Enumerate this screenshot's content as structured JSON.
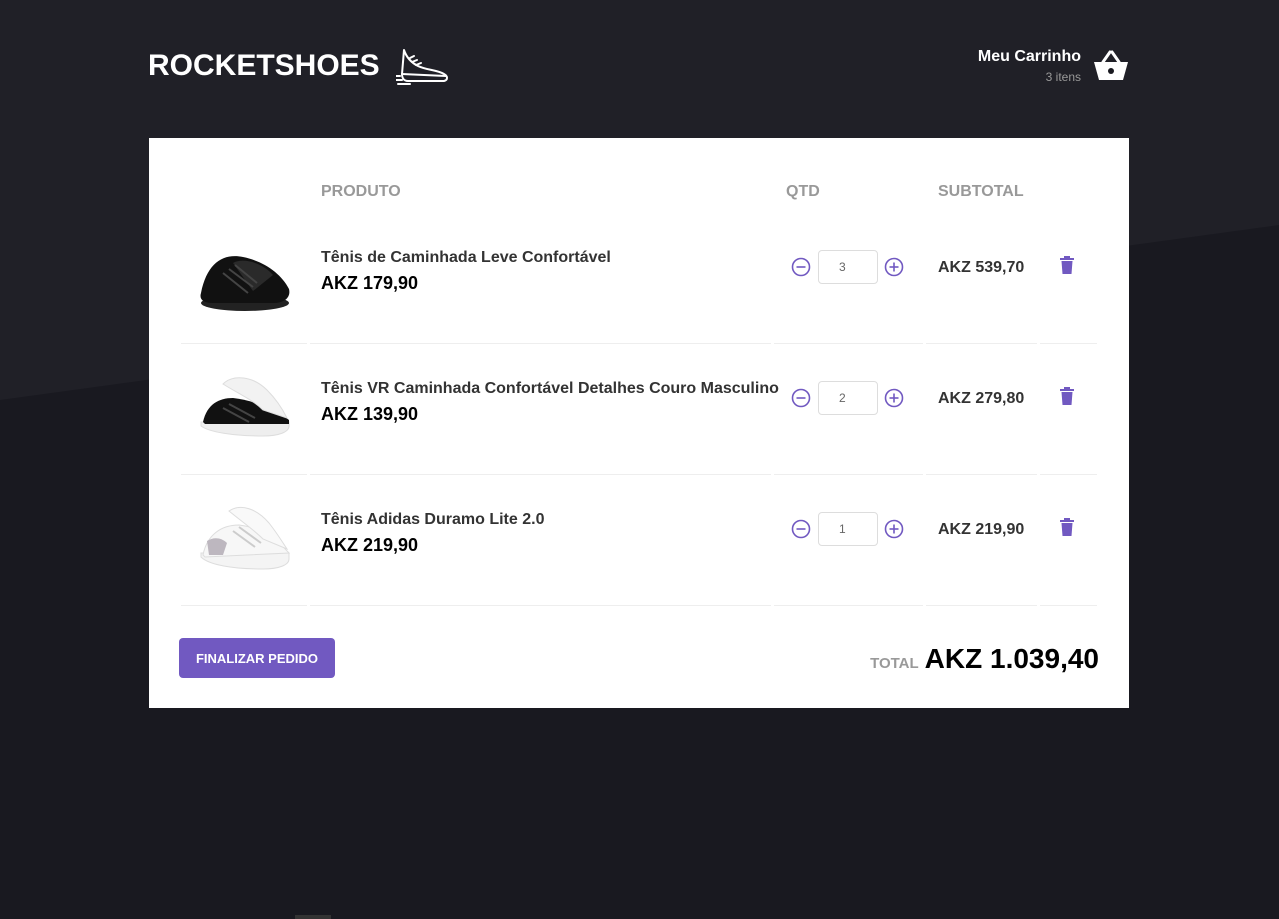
{
  "brand": {
    "name": "ROCKETSHOES",
    "logo_icon": "sneaker-icon"
  },
  "cart": {
    "title": "Meu Carrinho",
    "count": "3 itens",
    "icon": "basket-icon"
  },
  "table": {
    "headers": {
      "product": "PRODUTO",
      "qty": "QTD",
      "subtotal": "SUBTOTAL"
    },
    "items": [
      {
        "title": "Tênis de Caminhada Leve Confortável",
        "price": "AKZ 179,90",
        "qty": "3",
        "subtotal": "AKZ 539,70",
        "shoe_color": "black"
      },
      {
        "title": "Tênis VR Caminhada Confortável Detalhes Couro Masculino",
        "price": "AKZ 139,90",
        "qty": "2",
        "subtotal": "AKZ 279,80",
        "shoe_color": "black-white"
      },
      {
        "title": "Tênis Adidas Duramo Lite 2.0",
        "price": "AKZ 219,90",
        "qty": "1",
        "subtotal": "AKZ 219,90",
        "shoe_color": "white"
      }
    ]
  },
  "footer": {
    "finalize_label": "FINALIZAR PEDIDO",
    "total_label": "TOTAL",
    "total_value": "AKZ 1.039,40"
  },
  "colors": {
    "accent": "#7159c1",
    "background": "#191920",
    "panel": "#ffffff"
  }
}
